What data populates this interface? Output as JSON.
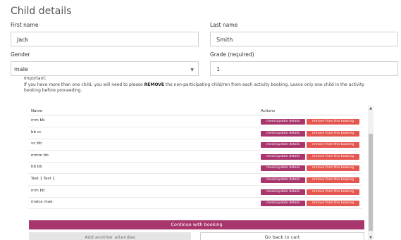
{
  "section_title": "Child details",
  "form": {
    "first_name_label": "First name",
    "first_name_value": "Jack",
    "last_name_label": "Last name",
    "last_name_value": "Smith",
    "gender_label": "Gender",
    "gender_value": "male",
    "grade_label": "Grade (required)",
    "grade_value": "1"
  },
  "notice": {
    "heading": "Important:",
    "text_before": "If you have more than one child, you will need to please ",
    "emphasis": "REMOVE",
    "text_after": " the non-participating child/ren from each activity booking. Leave only one child in the activity booking before proceeding."
  },
  "table": {
    "col_name": "Name",
    "col_actions": "Actions",
    "check_label": "check/update details",
    "remove_label": "remove from this booking",
    "rows": [
      {
        "name": "mm bb"
      },
      {
        "name": "bb cc"
      },
      {
        "name": "vv bb"
      },
      {
        "name": "mmm bb"
      },
      {
        "name": "bb bb"
      },
      {
        "name": "Test 1 Test 1"
      },
      {
        "name": "mm bb"
      },
      {
        "name": "maica mae"
      }
    ]
  },
  "buttons": {
    "continue": "Continue with booking",
    "add_attendee": "Add another attendee",
    "back_to_cart": "Go back to cart"
  },
  "colors": {
    "primary": "#a8356b",
    "danger": "#e4564f"
  }
}
